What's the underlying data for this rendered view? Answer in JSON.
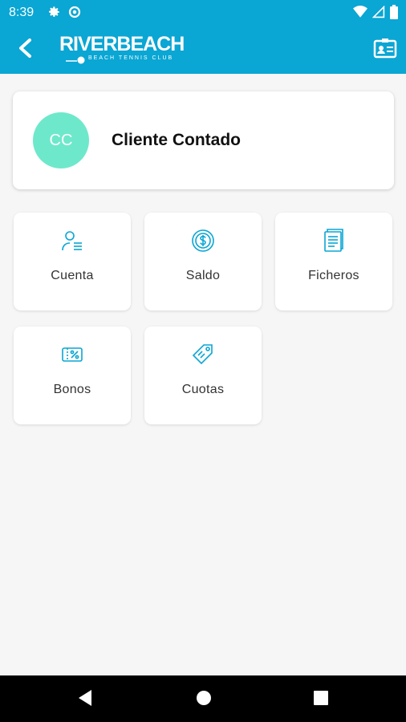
{
  "status_bar": {
    "time": "8:39",
    "left_icons": [
      "gear-icon",
      "data-saver-icon"
    ],
    "right_icons": [
      "wifi-icon",
      "signal-icon",
      "battery-icon"
    ]
  },
  "app_bar": {
    "logo_title": "RIVERBEACH",
    "logo_subtitle": "BEACH TENNIS CLUB",
    "left_icon": "back-arrow-icon",
    "right_icon": "id-card-icon",
    "color": "#0aa6d4"
  },
  "profile": {
    "initials": "CC",
    "name": "Cliente Contado",
    "avatar_color": "#6ee8cb"
  },
  "menu": {
    "items": [
      {
        "label": "Cuenta",
        "icon": "user-list-icon"
      },
      {
        "label": "Saldo",
        "icon": "coin-dollar-icon"
      },
      {
        "label": "Ficheros",
        "icon": "document-icon"
      },
      {
        "label": "Bonos",
        "icon": "percent-ticket-icon"
      },
      {
        "label": "Cuotas",
        "icon": "price-tag-icon"
      }
    ],
    "icon_color": "#0aa6d4"
  },
  "nav_bar": {
    "buttons": [
      "back-triangle-icon",
      "home-circle-icon",
      "recents-square-icon"
    ]
  }
}
